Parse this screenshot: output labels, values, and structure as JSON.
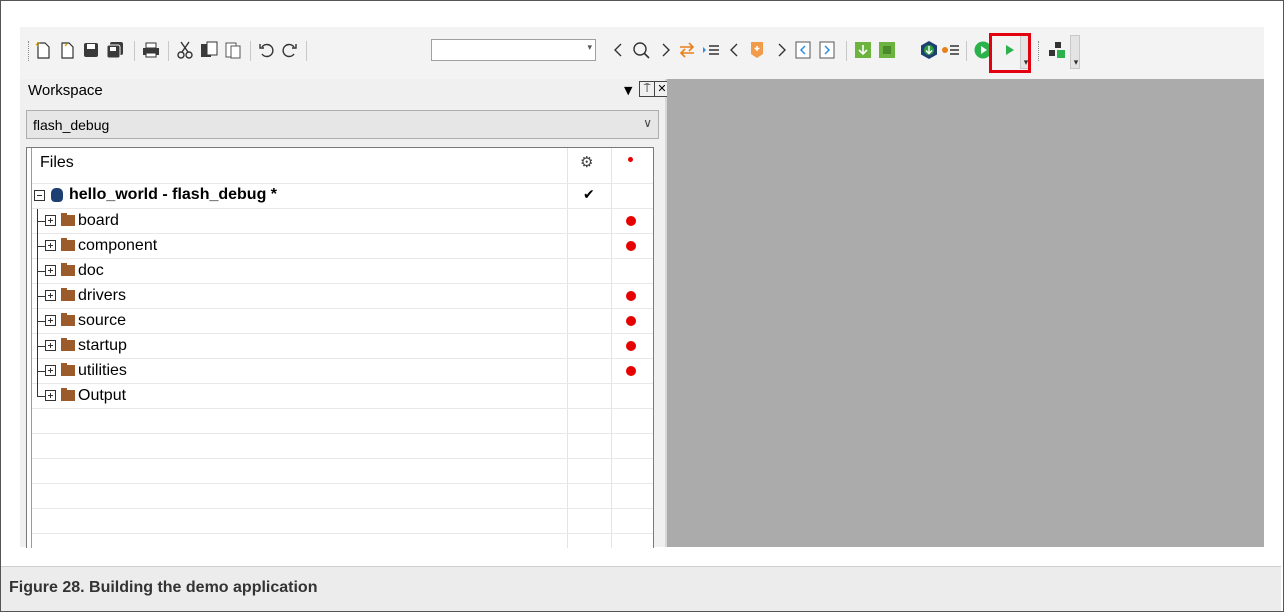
{
  "toolbar": {
    "icons": [
      "new-file",
      "open-file",
      "save",
      "save-all",
      "print",
      "cut",
      "copy",
      "paste",
      "undo",
      "redo",
      "search",
      "navigate-back",
      "navigate-forward",
      "go-to-definition",
      "step-back",
      "bookmark",
      "step-forward",
      "previous-file",
      "next-file",
      "compile",
      "make",
      "download-and-debug",
      "debug-without-download",
      "go",
      "run",
      "overflow",
      "workspace-layout"
    ],
    "combo_value": "",
    "highlighted_button": "download-and-debug",
    "highlight_color": "#e3000f"
  },
  "workspace": {
    "title": "Workspace",
    "pin_label": "◻",
    "close_label": "✕",
    "configuration": "flash_debug",
    "files_header": "Files",
    "project": {
      "name": "hello_world - flash_debug *",
      "check": "✔"
    },
    "folders": [
      {
        "name": "board",
        "modified": true
      },
      {
        "name": "component",
        "modified": true
      },
      {
        "name": "doc",
        "modified": false
      },
      {
        "name": "drivers",
        "modified": true
      },
      {
        "name": "source",
        "modified": true
      },
      {
        "name": "startup",
        "modified": true
      },
      {
        "name": "utilities",
        "modified": true
      },
      {
        "name": "Output",
        "modified": false
      }
    ]
  },
  "colors": {
    "accent_red": "#e60000",
    "folder": "#9c5b2a",
    "project_icon": "#1e3f72",
    "editor_bg": "#ababab"
  },
  "caption": "Figure 28.  Building the demo application"
}
